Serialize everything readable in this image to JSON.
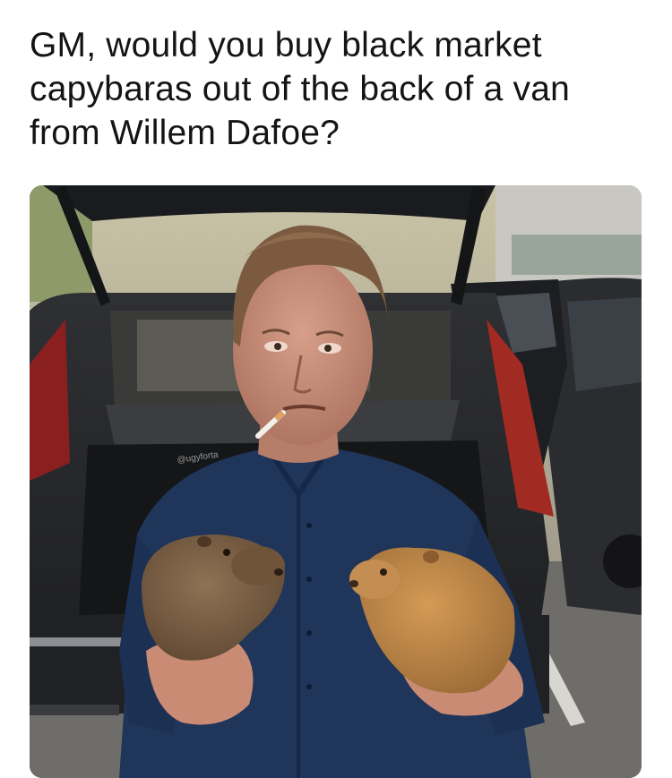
{
  "post": {
    "caption_lines": [
      "GM, would you buy black market",
      "capybaras out of the back of a van",
      "from Willem Dafoe?"
    ]
  },
  "photo": {
    "watermark": "@ugyforta",
    "subject": "man-holding-two-capybaras",
    "palette": {
      "shirt": "#1f3559",
      "car": "#2a2b2e",
      "capybara": "#b07e45",
      "asphalt": "#6f6d6a"
    }
  }
}
